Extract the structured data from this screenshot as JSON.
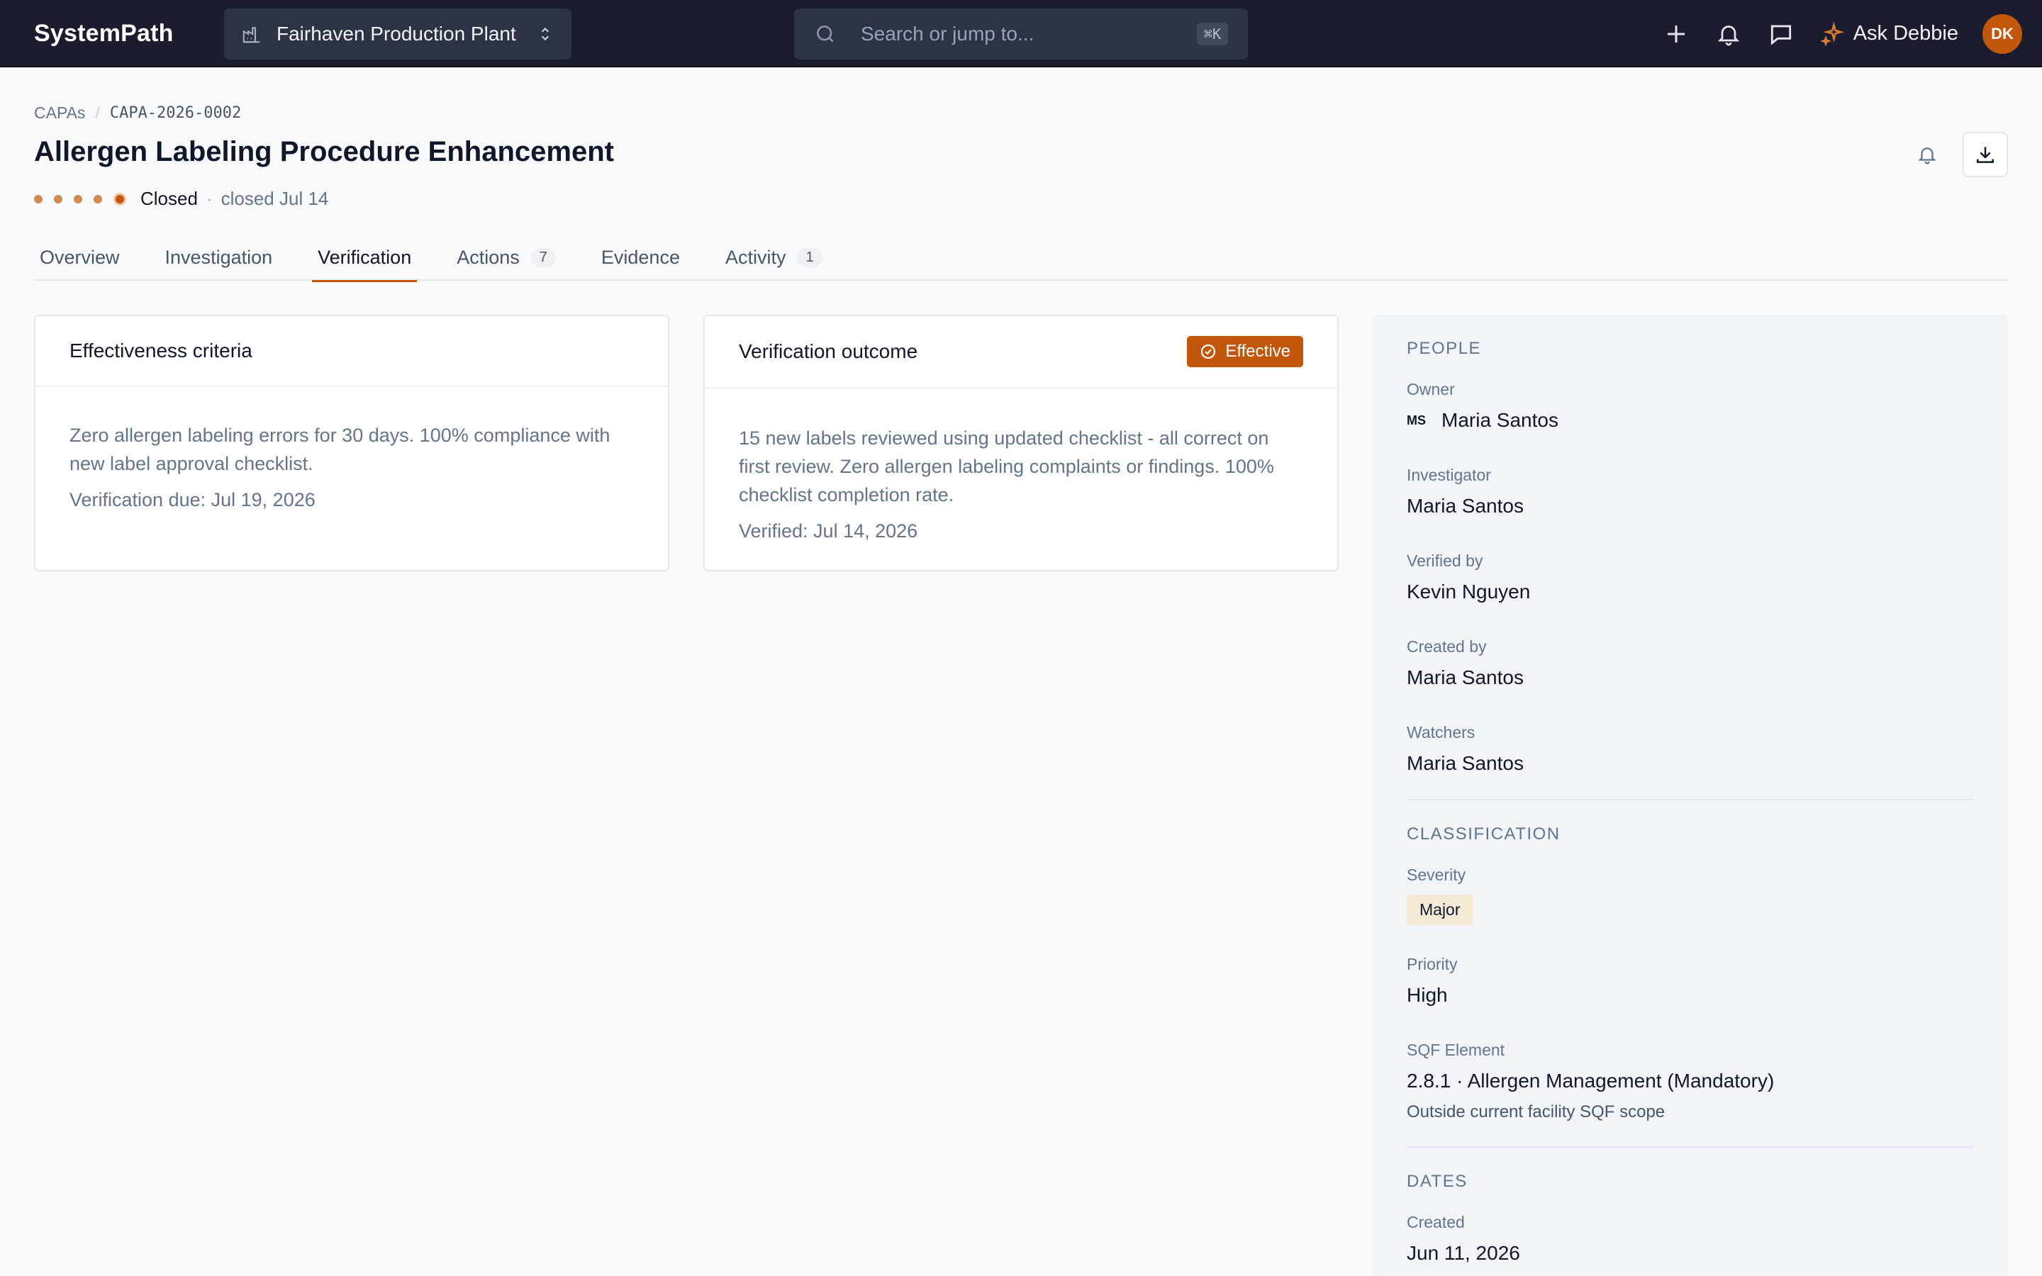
{
  "app": {
    "logo": "SystemPath",
    "site": "Fairhaven Production Plant",
    "search_placeholder": "Search or jump to...",
    "search_shortcut": "⌘K",
    "ask_label": "Ask Debbie",
    "user_initials": "DK"
  },
  "breadcrumb": {
    "root": "CAPAs",
    "current": "CAPA-2026-0002"
  },
  "page": {
    "title": "Allergen Labeling Procedure Enhancement",
    "status": "Closed",
    "status_date": "closed Jul 14",
    "progress_steps_completed": 5,
    "progress_steps_total": 5
  },
  "tabs": [
    {
      "label": "Overview",
      "count": ""
    },
    {
      "label": "Investigation",
      "count": ""
    },
    {
      "label": "Verification",
      "count": "",
      "active": true
    },
    {
      "label": "Actions",
      "count": "7"
    },
    {
      "label": "Evidence",
      "count": ""
    },
    {
      "label": "Activity",
      "count": "1"
    }
  ],
  "criteria_card": {
    "title": "Effectiveness criteria",
    "text": "Zero allergen labeling errors for 30 days. 100% compliance with new label approval checklist.",
    "meta": "Verification due: Jul 19, 2026"
  },
  "outcome_card": {
    "title": "Verification outcome",
    "badge": "Effective",
    "text": "15 new labels reviewed using updated checklist - all correct on first review. Zero allergen labeling complaints or findings. 100% checklist completion rate.",
    "meta": "Verified: Jul 14, 2026"
  },
  "sidebar": {
    "people": {
      "heading": "PEOPLE",
      "owner_label": "Owner",
      "owner_initials": "MS",
      "owner": "Maria Santos",
      "investigator_label": "Investigator",
      "investigator": "Maria Santos",
      "verified_by_label": "Verified by",
      "verified_by": "Kevin Nguyen",
      "created_by_label": "Created by",
      "created_by": "Maria Santos",
      "watchers_label": "Watchers",
      "watchers": "Maria Santos"
    },
    "classification": {
      "heading": "CLASSIFICATION",
      "severity_label": "Severity",
      "severity": "Major",
      "priority_label": "Priority",
      "priority": "High",
      "sqf_label": "SQF Element",
      "sqf": "2.8.1 · Allergen Management (Mandatory)",
      "sqf_note": "Outside current facility SQF scope"
    },
    "dates": {
      "heading": "DATES",
      "created_label": "Created",
      "created": "Jun 11, 2026"
    }
  },
  "colors": {
    "accent": "#c2570c",
    "topbar": "#1a1d2e",
    "severity_bg": "#f5ead6"
  }
}
